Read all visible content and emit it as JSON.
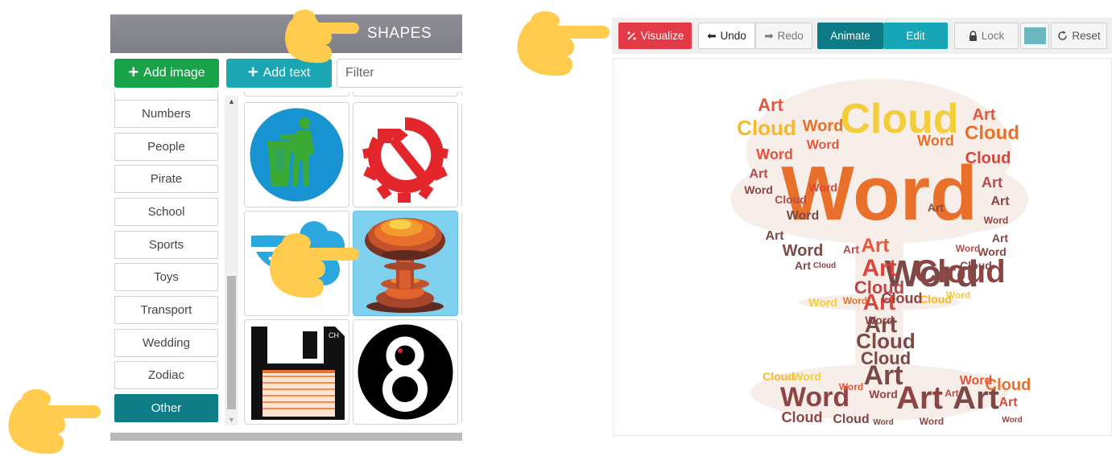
{
  "shapes_panel": {
    "title": "SHAPES",
    "add_image_label": "Add image",
    "add_text_label": "Add text",
    "filter_placeholder": "Filter",
    "categories": [
      "Numbers",
      "People",
      "Pirate",
      "School",
      "Sports",
      "Toys",
      "Transport",
      "Wedding",
      "Zodiac",
      "Other"
    ],
    "active_category": "Other",
    "tiles": [
      "tidy-man-icon",
      "hammer-and-gear-icon",
      "cloud-bird-icon",
      "mushroom-cloud-icon",
      "floppy-disk-icon",
      "eight-ball-icon"
    ],
    "selected_tile": "mushroom-cloud-icon",
    "floppy_label": "CH"
  },
  "toolbar": {
    "visualize_label": "Visualize",
    "undo_label": "Undo",
    "redo_label": "Redo",
    "animate_label": "Animate",
    "edit_label": "Edit",
    "lock_label": "Lock",
    "reset_label": "Reset",
    "color_swatch": "#6bb7bf"
  },
  "word_art": {
    "shape": "mushroom-cloud",
    "words": [
      "Word",
      "Cloud",
      "Art"
    ],
    "palette": [
      "#f5b92c",
      "#f2cd3c",
      "#e8702a",
      "#e8553a",
      "#d9453a",
      "#b54a4a",
      "#8f4444",
      "#7c4a46"
    ]
  },
  "icons": {
    "pointers": [
      "pointing-hand-icon",
      "pointing-hand-icon",
      "pointing-hand-icon",
      "pointing-hand-icon"
    ],
    "pointer_color": "#ffcc4d"
  }
}
